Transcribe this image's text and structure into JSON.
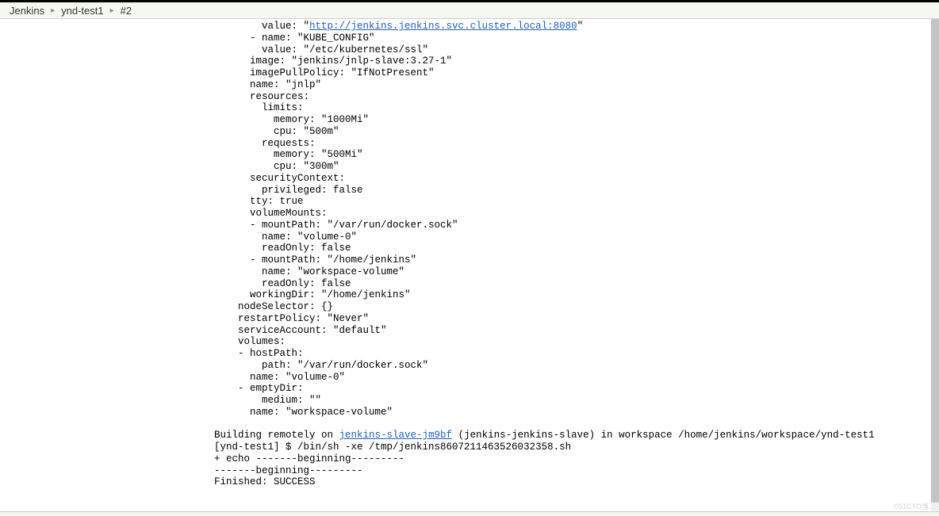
{
  "breadcrumb": {
    "items": [
      {
        "label": "Jenkins"
      },
      {
        "label": "ynd-test1"
      },
      {
        "label": "#2"
      }
    ]
  },
  "console": {
    "pre1": "        value: \"",
    "url1": "http://jenkins.jenkins.svc.cluster.local:8080",
    "post1": "\"\n      - name: \"KUBE_CONFIG\"\n        value: \"/etc/kubernetes/ssl\"\n      image: \"jenkins/jnlp-slave:3.27-1\"\n      imagePullPolicy: \"IfNotPresent\"\n      name: \"jnlp\"\n      resources:\n        limits:\n          memory: \"1000Mi\"\n          cpu: \"500m\"\n        requests:\n          memory: \"500Mi\"\n          cpu: \"300m\"\n      securityContext:\n        privileged: false\n      tty: true\n      volumeMounts:\n      - mountPath: \"/var/run/docker.sock\"\n        name: \"volume-0\"\n        readOnly: false\n      - mountPath: \"/home/jenkins\"\n        name: \"workspace-volume\"\n        readOnly: false\n      workingDir: \"/home/jenkins\"\n    nodeSelector: {}\n    restartPolicy: \"Never\"\n    serviceAccount: \"default\"\n    volumes:\n    - hostPath:\n        path: \"/var/run/docker.sock\"\n      name: \"volume-0\"\n    - emptyDir:\n        medium: \"\"\n      name: \"workspace-volume\"\n\nBuilding remotely on ",
    "url2_text": "jenkins-slave-jm9bf",
    "post2": " (jenkins-jenkins-slave) in workspace /home/jenkins/workspace/ynd-test1\n[ynd-test1] $ /bin/sh -xe /tmp/jenkins8607211463526032358.sh\n+ echo -------beginning---------\n-------beginning---------\nFinished: SUCCESS"
  },
  "watermark": "©51CTO博…"
}
